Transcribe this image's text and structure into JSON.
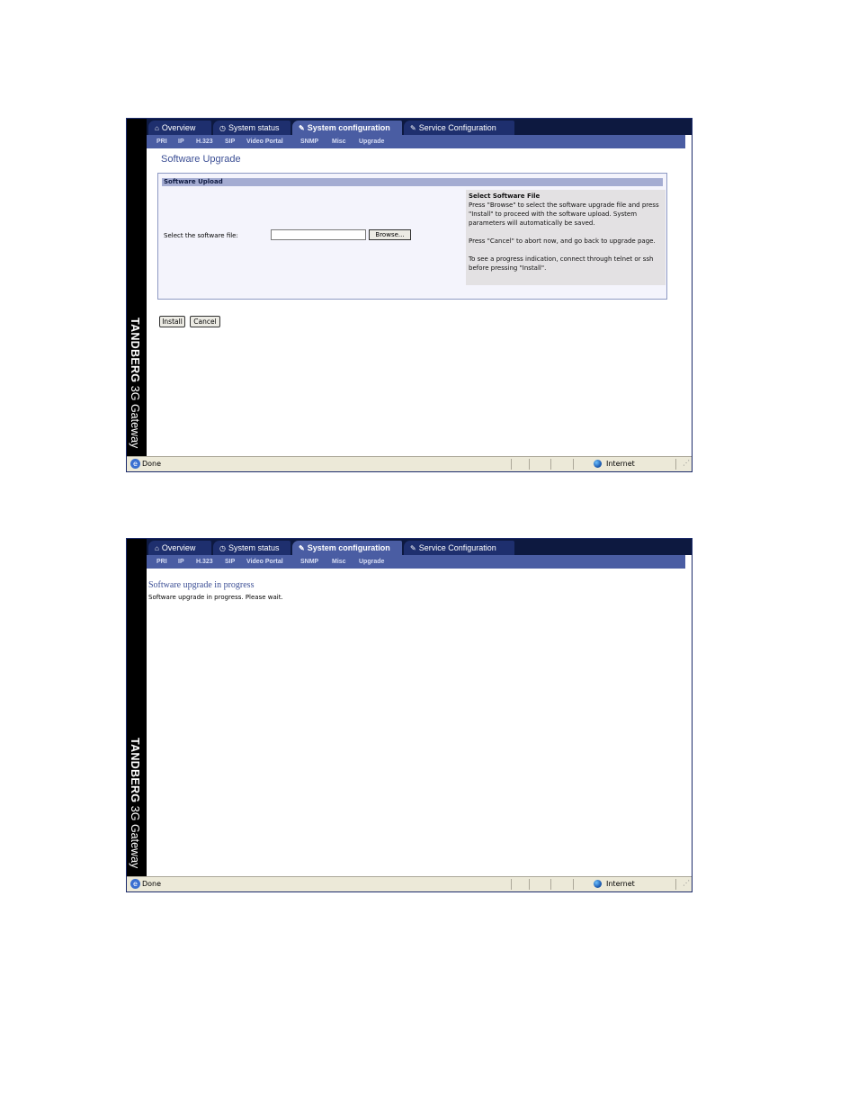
{
  "brand": {
    "name": "TANDBERG",
    "product": "3G Gateway"
  },
  "tabs": [
    {
      "icon": "home-icon",
      "glyph": "⌂",
      "label": "Overview"
    },
    {
      "icon": "status-icon",
      "glyph": "◷",
      "label": "System status"
    },
    {
      "icon": "wrench-icon",
      "glyph": "✎",
      "label": "System configuration",
      "active": true
    },
    {
      "icon": "wrench-icon",
      "glyph": "✎",
      "label": "Service Configuration"
    }
  ],
  "subnav": [
    "PRI",
    "IP",
    "H.323",
    "SIP",
    "Video Portal",
    "SNMP",
    "Misc",
    "Upgrade"
  ],
  "upload_page": {
    "title": "Software Upgrade",
    "panel_title": "Software Upload",
    "file_label": "Select the software file:",
    "file_value": "",
    "browse_label": "Browse...",
    "help": {
      "title": "Select Software File",
      "p1": "Press \"Browse\" to select the software upgrade file and press \"Install\" to proceed with the software upload. System parameters will automatically be saved.",
      "p2": "Press \"Cancel\" to abort now, and go back to upgrade page.",
      "p3": "To see a progress indication, connect through telnet or ssh before pressing \"Install\"."
    },
    "install_label": "Install",
    "cancel_label": "Cancel"
  },
  "progress_page": {
    "title": "Software upgrade in progress",
    "message": "Software upgrade in progress. Please wait."
  },
  "statusbar": {
    "status": "Done",
    "zone": "Internet"
  }
}
